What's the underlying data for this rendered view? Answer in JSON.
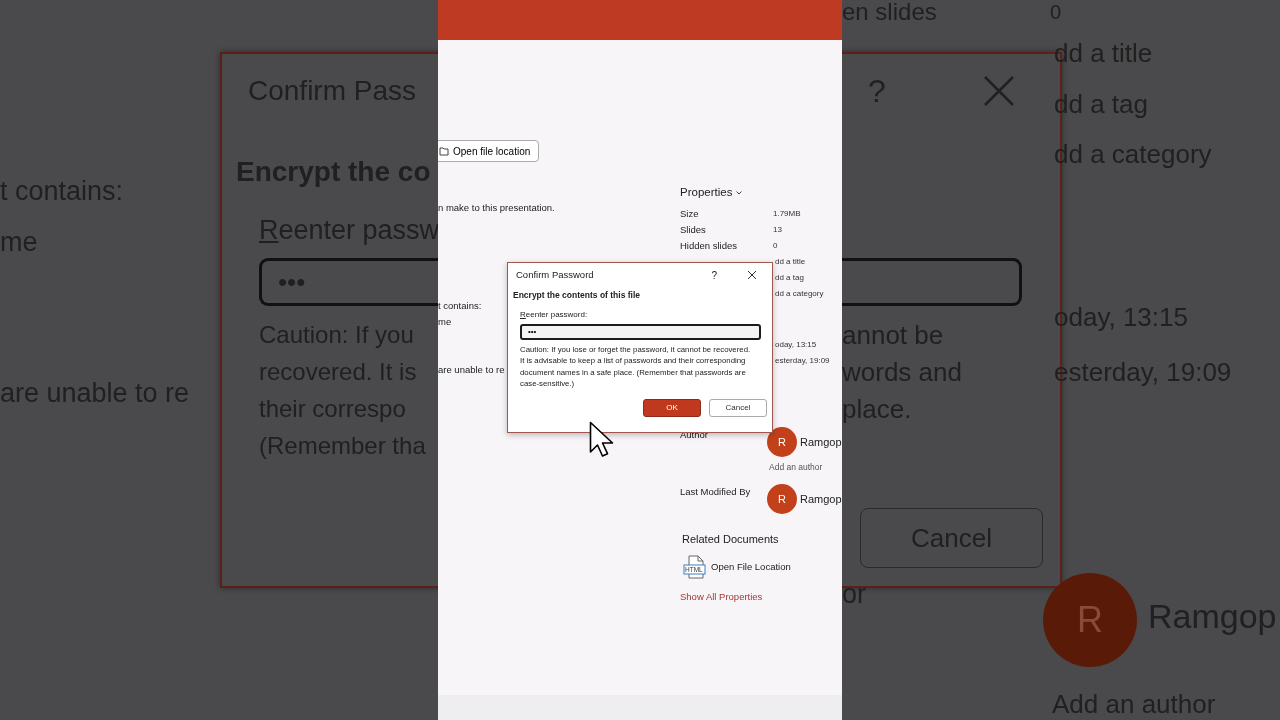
{
  "backdrop": {
    "left_texts": [
      "t contains:",
      "me",
      "are unable to re"
    ],
    "dialog_left": {
      "title": "Confirm Pass",
      "heading": "Encrypt the co",
      "field_label": "Reenter passw",
      "field_value": "•••",
      "caution_lines": [
        "Caution: If you",
        "recovered. It is",
        "their correspo",
        "(Remember tha"
      ]
    },
    "dialog_right": {
      "help": "?",
      "caution_lines": [
        "annot be",
        "words and",
        "place."
      ],
      "cancel": "Cancel"
    },
    "right_props": {
      "top_label": "en slides",
      "top_value": "0",
      "values": [
        "dd a title",
        "dd a tag",
        "dd a category",
        "oday, 13:15",
        "esterday, 19:09"
      ],
      "author_label": "or",
      "avatar": "R",
      "author_name": "Ramgop",
      "add_author": "Add an author"
    }
  },
  "app": {
    "open_location_button": "Open file location",
    "texts": [
      "n make to this presentation.",
      "t contains:",
      "me",
      "are unable to re"
    ],
    "properties": {
      "heading": "Properties",
      "rows": [
        {
          "label": "Size",
          "value": "1.79MB"
        },
        {
          "label": "Slides",
          "value": "13"
        },
        {
          "label": "Hidden slides",
          "value": "0"
        }
      ],
      "values": [
        "dd a title",
        "dd a tag",
        "dd a category"
      ],
      "dates": [
        "oday, 13:15",
        "esterday, 19:09"
      ],
      "author": {
        "label": "Author",
        "initial": "R",
        "name": "Ramgop"
      },
      "add_author": "Add an author",
      "last_modified": {
        "label": "Last Modified By",
        "initial": "R",
        "name": "Ramgop"
      }
    },
    "related": {
      "heading": "Related Documents",
      "icon_label": "HTML",
      "item": "Open File Location",
      "show_all": "Show All Properties"
    }
  },
  "dialog": {
    "title": "Confirm Password",
    "help": "?",
    "heading": "Encrypt the contents of this file",
    "field_label": "Reenter password:",
    "field_value": "•••",
    "caution": "Caution: If you lose or forget the password, it cannot be recovered. It is advisable to keep a list of passwords and their corresponding document names in a safe place. (Remember that passwords are case-sensitive.)",
    "ok": "OK",
    "cancel": "Cancel"
  }
}
